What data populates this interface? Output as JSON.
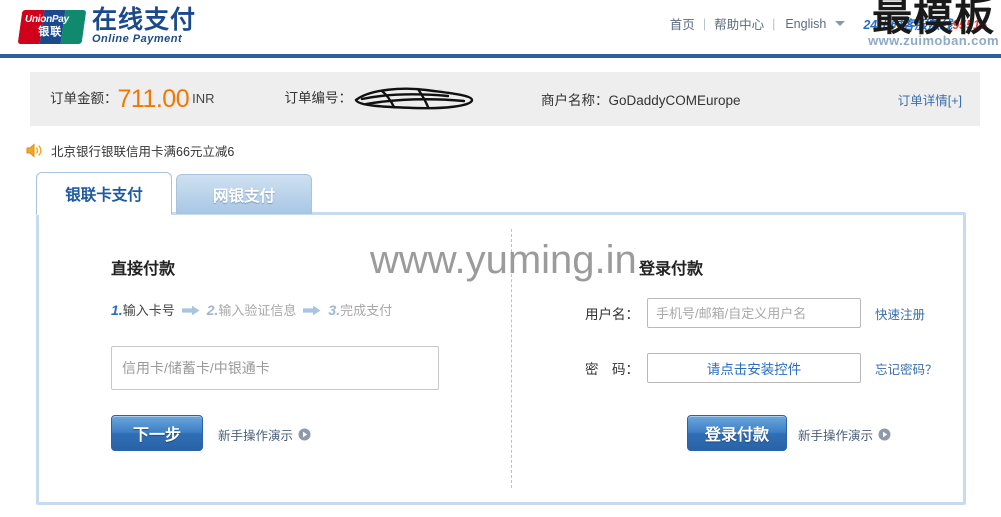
{
  "header": {
    "logo": {
      "mark_top": "UnionPay",
      "mark_bottom": "银联",
      "title_cn": "在线支付",
      "title_en": "Online  Payment"
    },
    "nav": {
      "home": "首页",
      "help": "帮助中心",
      "language": "English",
      "separator": "|",
      "hotline_prefix": "24小时客服热线",
      "hotline_number": "95516"
    },
    "watermark": {
      "big": "最模板",
      "small": "www.zuimoban.com"
    }
  },
  "order": {
    "amount_label": "订单金额：",
    "amount_value": "711.00",
    "currency": "INR",
    "order_no_label": "订单编号：",
    "order_no_value": "",
    "merchant_label": "商户名称：",
    "merchant_value": "GoDaddyCOMEurope",
    "details_link": "订单详情[+]"
  },
  "notice": {
    "icon": "speaker-icon",
    "text": "北京银行银联信用卡满66元立减6"
  },
  "tabs": [
    {
      "label": "银联卡支付",
      "active": true
    },
    {
      "label": "网银支付",
      "active": false
    }
  ],
  "direct_pay": {
    "title": "直接付款",
    "steps": [
      {
        "num": "1.",
        "text": "输入卡号"
      },
      {
        "num": "2.",
        "text": "输入验证信息"
      },
      {
        "num": "3.",
        "text": "完成支付"
      }
    ],
    "card_input_placeholder": "信用卡/储蓄卡/中银通卡",
    "card_input_value": "",
    "next_button": "下一步",
    "demo_link": "新手操作演示"
  },
  "login_pay": {
    "title": "登录付款",
    "username_label": "用户名：",
    "username_placeholder": "手机号/邮箱/自定义用户名",
    "username_value": "",
    "register_link": "快速注册",
    "password_label": "密　码：",
    "password_prompt": "请点击安装控件",
    "forgot_link": "忘记密码？",
    "login_button": "登录付款",
    "demo_link": "新手操作演示"
  },
  "watermark_center": "www.yuming.in",
  "colors": {
    "unionpay_red": "#d0021b",
    "unionpay_blue": "#1b4a8c",
    "unionpay_green": "#0f8a6e",
    "rule_blue": "#2e5f9e",
    "amount_orange": "#f07800",
    "link_blue": "#3a6ea8",
    "panel_border": "#c7dbef"
  }
}
